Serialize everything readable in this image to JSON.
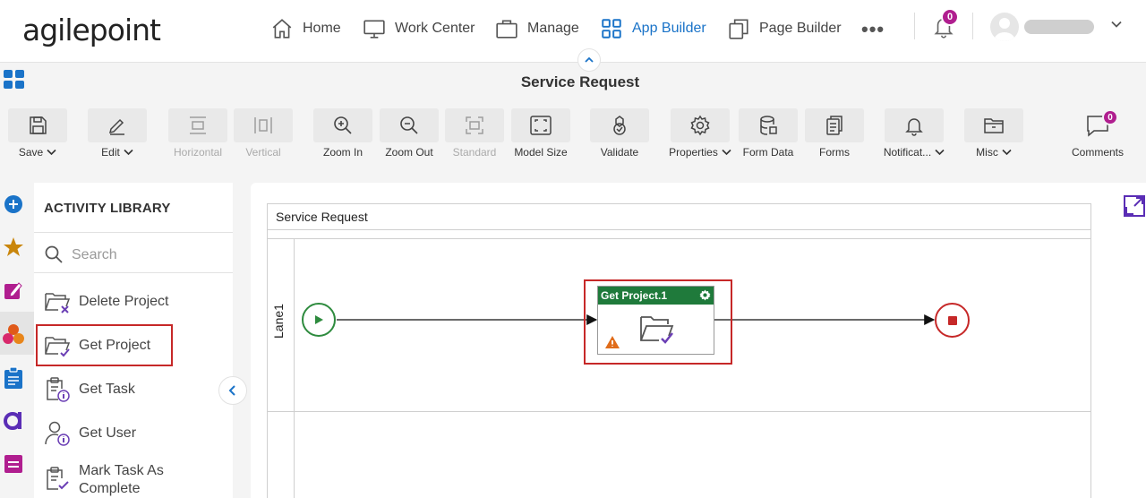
{
  "brand": {
    "logo_text": "agilepoint"
  },
  "nav": {
    "items": [
      {
        "label": "Home",
        "icon": "home-icon"
      },
      {
        "label": "Work Center",
        "icon": "monitor-icon"
      },
      {
        "label": "Manage",
        "icon": "briefcase-icon"
      },
      {
        "label": "App Builder",
        "icon": "grid-icon",
        "active": true
      },
      {
        "label": "Page Builder",
        "icon": "pages-icon"
      }
    ],
    "more_label": "•••",
    "notification_count": "0"
  },
  "header": {
    "title": "Service Request"
  },
  "toolbar": {
    "save": "Save",
    "edit": "Edit",
    "horizontal": "Horizontal",
    "vertical": "Vertical",
    "zoom_in": "Zoom In",
    "zoom_out": "Zoom Out",
    "standard": "Standard",
    "model_size": "Model Size",
    "validate": "Validate",
    "properties": "Properties",
    "form_data": "Form Data",
    "forms": "Forms",
    "notifications": "Notificat...",
    "misc": "Misc",
    "comments": "Comments",
    "comments_count": "0"
  },
  "library": {
    "title": "ACTIVITY LIBRARY",
    "search_placeholder": "Search",
    "items": [
      {
        "label": "Delete Project",
        "icon": "folder-delete-icon"
      },
      {
        "label": "Get Project",
        "icon": "folder-check-icon",
        "highlighted": true
      },
      {
        "label": "Get Task",
        "icon": "clipboard-info-icon"
      },
      {
        "label": "Get User",
        "icon": "user-info-icon"
      },
      {
        "label": "Mark Task As Complete",
        "icon": "clipboard-check-icon"
      }
    ]
  },
  "canvas": {
    "pool_title": "Service Request",
    "lane_label": "Lane1",
    "task_title": "Get Project.1"
  },
  "colors": {
    "accent": "#1a73c8",
    "badge": "#b01e8f",
    "task_header": "#1f7a3b",
    "start": "#2e8b3e",
    "end": "#c62828",
    "highlight": "#c62828",
    "warning": "#e06c1a"
  }
}
